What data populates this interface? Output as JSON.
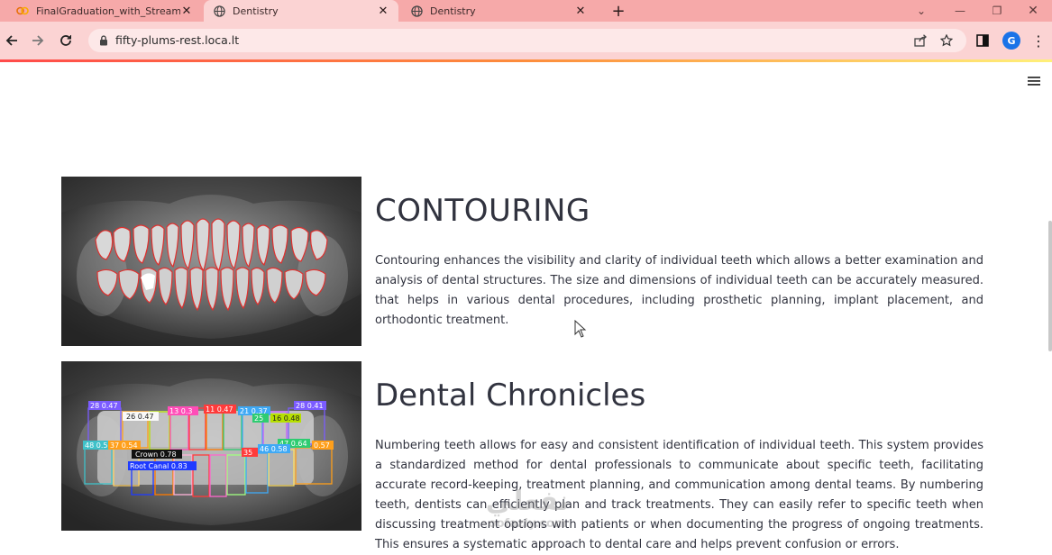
{
  "browser": {
    "tabs": [
      {
        "title": "FinalGraduation_with_Streamlit",
        "icon": "colab-icon",
        "active": false
      },
      {
        "title": "Dentistry",
        "icon": "globe-icon",
        "active": true
      },
      {
        "title": "Dentistry",
        "icon": "globe-icon",
        "active": false
      }
    ],
    "url": "fifty-plums-rest.loca.lt",
    "profile_initial": "G"
  },
  "colors": {
    "tabbar": "#f6a9a9",
    "toolbar": "#fbd3d3",
    "text": "#31333f",
    "contour": "#e0302e",
    "accent": "#ff4b4b"
  },
  "sections": [
    {
      "title": "CONTOURING",
      "text": "Contouring enhances the visibility and clarity of individual teeth which allows a better examination and analysis of dental structures. The size and dimensions of individual teeth can be accurately measured. that helps in various dental procedures, including prosthetic planning, implant placement, and orthodontic treatment.",
      "image": "xray-contouring"
    },
    {
      "title": "Dental Chronicles",
      "text": "Numbering teeth allows for easy and consistent identification of individual teeth. This system provides a standardized method for dental professionals to communicate about specific teeth, facilitating accurate record-keeping, treatment planning, and communication among dental teams. By numbering teeth, dentists can efficiently plan and track treatments. They can easily refer to specific teeth when discussing treatment options with patients or when documenting the progress of ongoing treatments. This ensures a systematic approach to dental care and helps prevent confusion or errors.",
      "image": "xray-numbering"
    }
  ],
  "detections": [
    {
      "label": "28 0.47"
    },
    {
      "label": "26 0.47"
    },
    {
      "label": "13 0.3"
    },
    {
      "label": "11 0.47"
    },
    {
      "label": "21 0.37"
    },
    {
      "label": "25"
    },
    {
      "label": "28 0.41"
    },
    {
      "label": "48 0.5"
    },
    {
      "label": "37 0.54"
    },
    {
      "label": "Crown 0.78"
    },
    {
      "label": "Root Canal 0.83"
    },
    {
      "label": "35"
    },
    {
      "label": "47 0.64"
    },
    {
      "label": "46 0.58"
    },
    {
      "label": "0.57"
    },
    {
      "label": "16 0.48"
    }
  ],
  "watermark": {
    "line1": "نفعلي",
    "line2": "oofazly.com"
  }
}
